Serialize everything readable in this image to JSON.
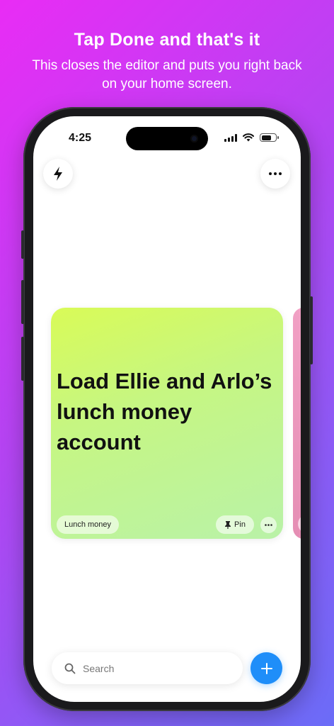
{
  "promo": {
    "headline": "Tap Done and that's it",
    "subline": "This closes the editor and puts you right back on your home screen."
  },
  "status_bar": {
    "time": "4:25"
  },
  "toolbar": {
    "left_icon": "bolt-icon",
    "right_icon": "more-icon"
  },
  "card": {
    "title": "Load Ellie and Arlo’s lunch money account",
    "tag": "Lunch money",
    "pin_label": "Pin",
    "more_icon": "more-icon",
    "colors": {
      "start": "#d9fb57",
      "end": "#b9f2a8"
    }
  },
  "search": {
    "placeholder": "Search"
  },
  "colors": {
    "accent": "#1f8ef9"
  }
}
